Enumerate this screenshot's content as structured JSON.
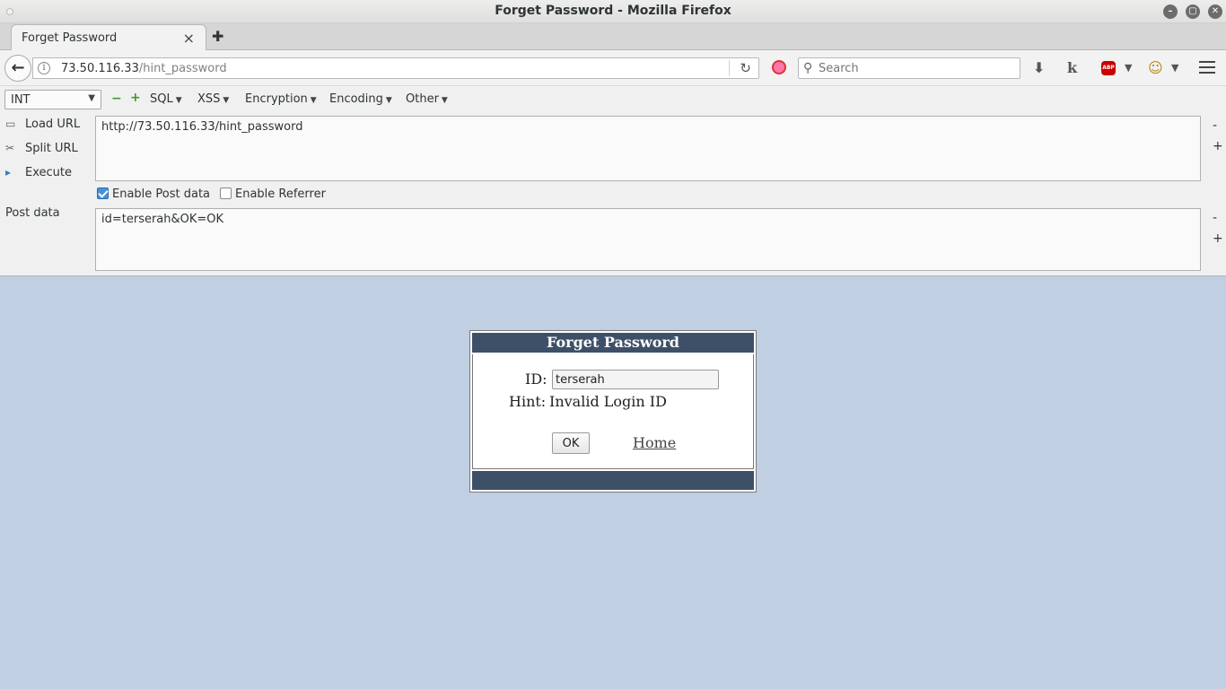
{
  "window": {
    "title": "Forget Password - Mozilla Firefox"
  },
  "tabs": [
    {
      "label": "Forget Password"
    }
  ],
  "navbar": {
    "url_host": "73.50.116.33",
    "url_path": "/hint_password",
    "search_placeholder": "Search"
  },
  "hackbar": {
    "encoding_select": "INT",
    "minus": "−",
    "plus": "+",
    "menus": [
      "SQL",
      "XSS",
      "Encryption",
      "Encoding",
      "Other"
    ],
    "actions": {
      "load": "Load URL",
      "split": "Split URL",
      "execute": "Execute"
    },
    "url_value": "http://73.50.116.33/hint_password",
    "enable_post_label": "Enable Post data",
    "enable_referrer_label": "Enable Referrer",
    "enable_post_checked": true,
    "enable_referrer_checked": false,
    "post_label": "Post data",
    "post_value": "id=terserah&OK=OK",
    "area_minus": "-",
    "area_plus": "+"
  },
  "page": {
    "dialog_title": "Forget Password",
    "id_label": "ID:",
    "id_value": "terserah",
    "hint_label": "Hint:",
    "hint_value": "Invalid Login ID",
    "ok_button": "OK",
    "home_link": "Home"
  },
  "colors": {
    "page_bg": "#c0cfe2",
    "dialog_header": "#3e5068"
  }
}
